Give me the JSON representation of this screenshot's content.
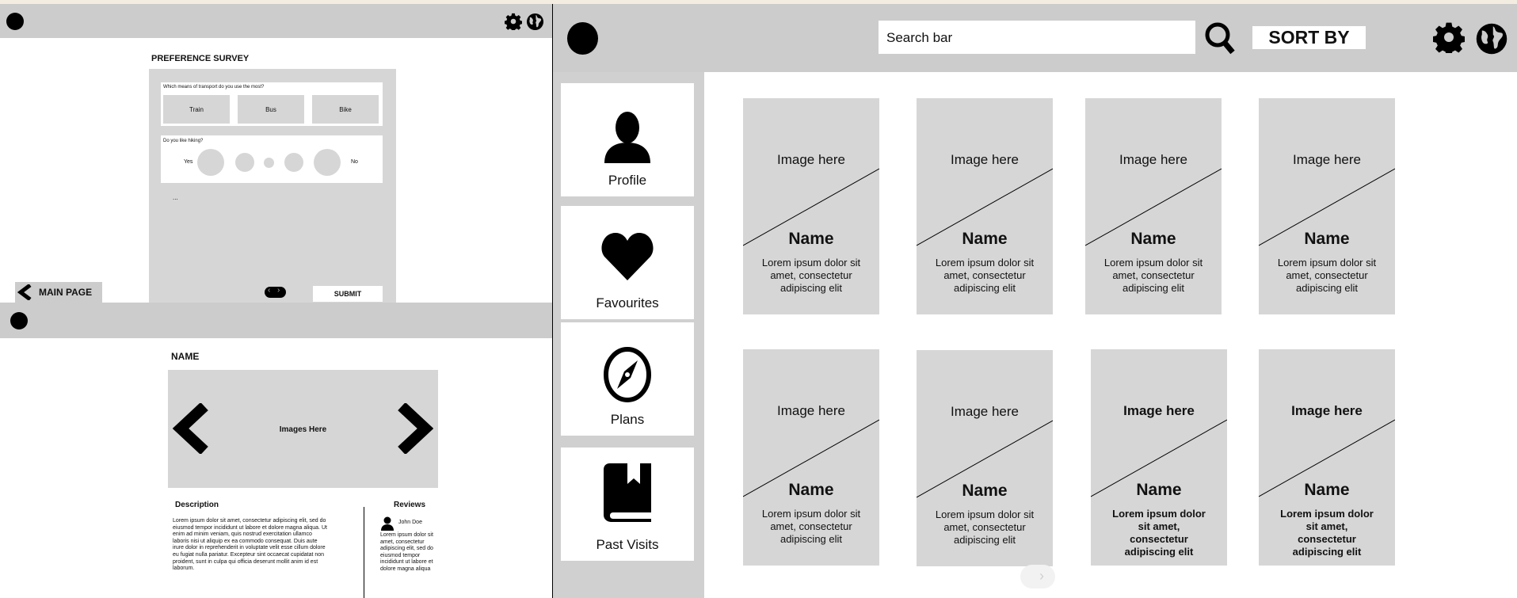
{
  "survey": {
    "title": "PREFERENCE SURVEY",
    "q1": "Which means of transport do you use the most?",
    "q1_options": [
      "Train",
      "Bus",
      "Bike"
    ],
    "q2": "Do you like hiking?",
    "q2_left": "Yes",
    "q2_right": "No",
    "ellipsis": "...",
    "back_label": "MAIN PAGE",
    "submit_label": "SUBMIT"
  },
  "detail": {
    "title": "NAME",
    "images_label": "Images Here",
    "description_heading": "Description",
    "description_text": "Lorem ipsum dolor sit amet, consectetur adipiscing elit, sed do eiusmod tempor incididunt ut labore et dolore magna aliqua. Ut enim ad minim veniam, quis nostrud exercitation ullamco laboris nisi ut aliquip ex ea commodo consequat. Duis aute irure dolor in reprehenderit in voluptate velit esse cillum dolore eu fugiat nulla pariatur. Excepteur sint occaecat cupidatat non proident, sunt in culpa qui officia deserunt mollit anim id est laborum.",
    "reviews_heading": "Reviews",
    "reviewer": "John Doe",
    "review_text": "Lorem ipsum dolor sit amet, consectetur adipiscing elit, sed do eiusmod tempor incididunt ut labore et dolore magna aliqua"
  },
  "main": {
    "search_placeholder": "Search bar",
    "sort_label": "SORT BY",
    "nav": [
      {
        "label": "Profile",
        "icon": "profile-icon"
      },
      {
        "label": "Favourites",
        "icon": "heart-icon"
      },
      {
        "label": "Plans",
        "icon": "compass-icon"
      },
      {
        "label": "Past Visits",
        "icon": "book-icon"
      }
    ],
    "cards": [
      {
        "image": "Image here",
        "name": "Name",
        "desc": "Lorem ipsum dolor sit amet, consectetur adipiscing elit"
      },
      {
        "image": "Image here",
        "name": "Name",
        "desc": "Lorem ipsum dolor sit amet, consectetur adipiscing elit"
      },
      {
        "image": "Image here",
        "name": "Name",
        "desc": "Lorem ipsum dolor sit amet, consectetur adipiscing elit"
      },
      {
        "image": "Image here",
        "name": "Name",
        "desc": "Lorem ipsum dolor sit amet, consectetur adipiscing elit"
      },
      {
        "image": "Image here",
        "name": "Name",
        "desc": "Lorem ipsum dolor sit amet, consectetur adipiscing elit"
      },
      {
        "image": "Image here",
        "name": "Name",
        "desc": "Lorem ipsum dolor sit amet, consectetur adipiscing elit"
      },
      {
        "image": "Image here",
        "name": "Name",
        "desc": "Lorem ipsum dolor sit amet, consectetur adipiscing elit"
      },
      {
        "image": "Image here",
        "name": "Name",
        "desc": "Lorem ipsum dolor sit amet, consectetur adipiscing elit"
      }
    ]
  },
  "colors": {
    "bar": "#cccccc",
    "block": "#d6d6d6",
    "backdrop": "#f3ede1"
  }
}
